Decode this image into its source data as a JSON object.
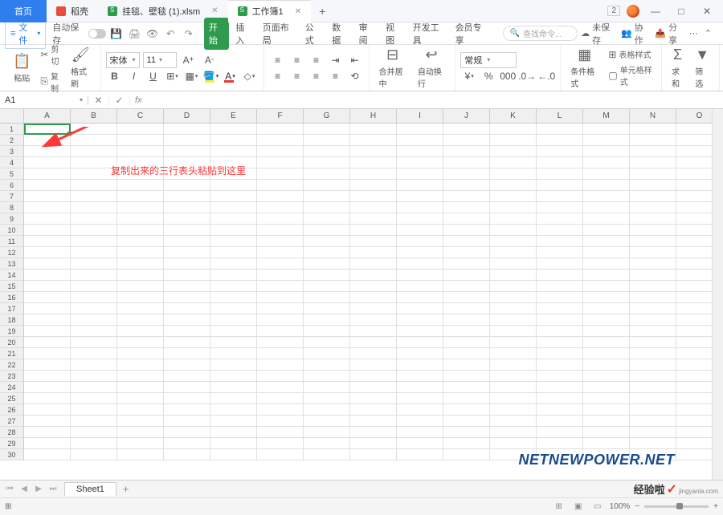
{
  "titlebar": {
    "home_tab": "首页",
    "tab1": "稻壳",
    "tab2": "挂毯、壁毯 (1).xlsm",
    "tab3": "工作簿1",
    "badge": "2"
  },
  "menubar": {
    "file": "文件",
    "autosave": "自动保存",
    "search_placeholder": "查找命令...",
    "unsaved": "未保存",
    "collab": "协作",
    "share": "分享"
  },
  "ribbon_tabs": [
    "开始",
    "插入",
    "页面布局",
    "公式",
    "数据",
    "审阅",
    "视图",
    "开发工具",
    "会员专享"
  ],
  "ribbon": {
    "paste": "粘贴",
    "cut": "剪切",
    "copy": "复制",
    "format_painter": "格式刷",
    "font_name": "宋体",
    "font_size": "11",
    "merge": "合并居中",
    "wrap": "自动换行",
    "number_format": "常规",
    "cond_format": "条件格式",
    "table_style": "表格样式",
    "cell_style": "单元格样式",
    "sum": "求和",
    "filter": "筛选"
  },
  "name_box": "A1",
  "formula": "fx",
  "columns": [
    "A",
    "B",
    "C",
    "D",
    "E",
    "F",
    "G",
    "H",
    "I",
    "J",
    "K",
    "L",
    "M",
    "N",
    "O"
  ],
  "rows": [
    "1",
    "2",
    "3",
    "4",
    "5",
    "6",
    "7",
    "8",
    "9",
    "10",
    "11",
    "12",
    "13",
    "14",
    "15",
    "16",
    "17",
    "18",
    "19",
    "20",
    "21",
    "22",
    "23",
    "24",
    "25",
    "26",
    "27",
    "28",
    "29",
    "30"
  ],
  "annotation": "复制出来的三行表头粘贴到这里",
  "sheet": {
    "name": "Sheet1"
  },
  "status": {
    "zoom": "100%"
  },
  "watermark1": "NETNEWPOWER.NET",
  "watermark2": "经验啦",
  "watermark2_sub": "jingyanla.com"
}
